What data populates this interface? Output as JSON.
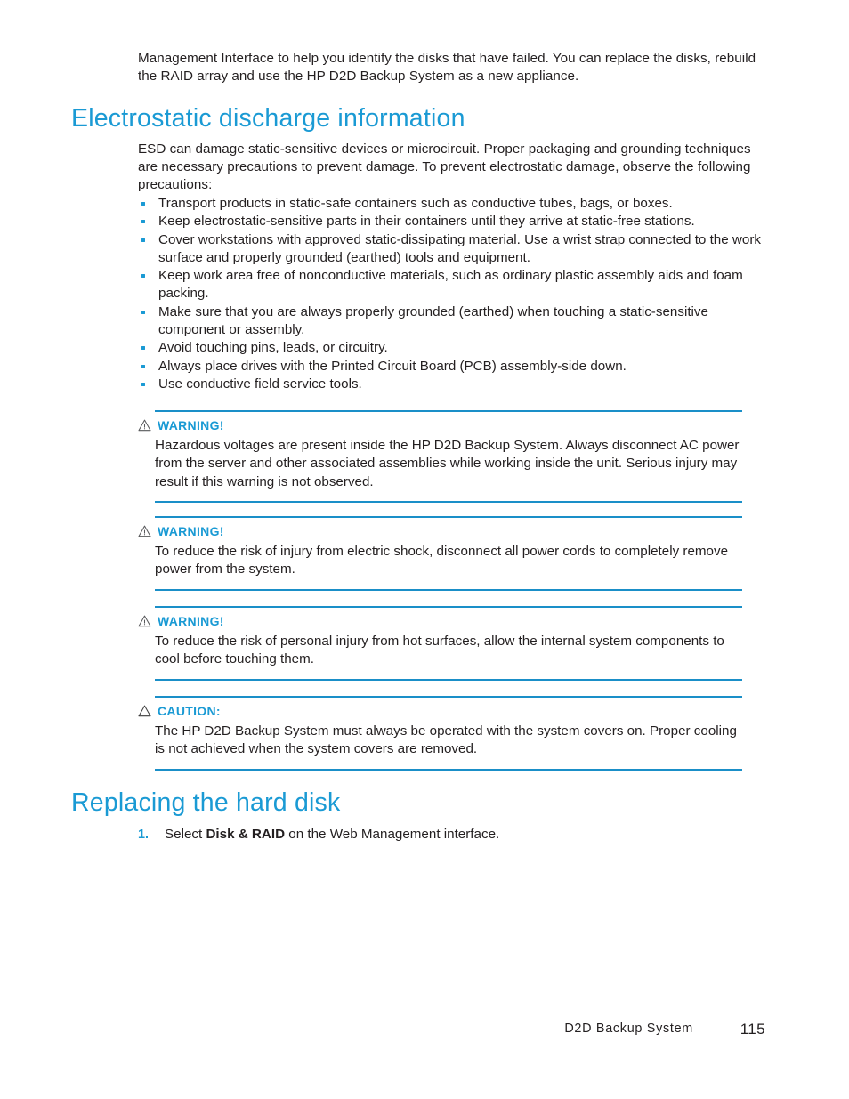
{
  "intro": {
    "paragraph": "Management Interface to help you identify the disks that have failed.  You can replace the disks, rebuild the RAID array and use the HP D2D Backup System as a new appliance."
  },
  "esd_section": {
    "heading": "Electrostatic discharge information",
    "paragraph": "ESD can damage static-sensitive devices or microcircuit.  Proper packaging and grounding techniques are necessary precautions to prevent damage.  To prevent electrostatic damage, observe the following precautions:",
    "bullets": [
      "Transport products in static-safe containers such as conductive tubes, bags, or boxes.",
      "Keep electrostatic-sensitive parts in their containers until they arrive at static-free stations.",
      "Cover workstations with approved static-dissipating material.  Use a wrist strap connected to the work surface and properly grounded (earthed) tools and equipment.",
      "Keep work area free of nonconductive materials, such as ordinary plastic assembly aids and foam packing.",
      "Make sure that you are always properly grounded (earthed) when touching a static-sensitive component or assembly.",
      "Avoid touching pins, leads, or circuitry.",
      "Always place drives with the Printed Circuit Board (PCB) assembly-side down.",
      "Use conductive field service tools."
    ]
  },
  "admonitions": [
    {
      "icon": "warning-triangle-icon",
      "label": "WARNING!",
      "text": "Hazardous voltages are present inside the HP D2D Backup System.  Always disconnect AC power from the server and other associated assemblies while working inside the unit. Serious injury may result if this warning is not observed."
    },
    {
      "icon": "warning-triangle-icon",
      "label": "WARNING!",
      "text": "To reduce the risk of injury from electric shock, disconnect all power cords to completely remove power from the system."
    },
    {
      "icon": "warning-triangle-icon",
      "label": "WARNING!",
      "text": "To reduce the risk of personal injury from hot surfaces, allow the internal system components to cool before touching them."
    },
    {
      "icon": "caution-triangle-icon",
      "label": "CAUTION:",
      "text": "The HP D2D Backup System must always be operated with the system covers on.  Proper cooling is not achieved when the system covers are removed."
    }
  ],
  "replace_section": {
    "heading": "Replacing the hard disk",
    "steps": [
      {
        "number": "1.",
        "prefix": "Select ",
        "bold": "Disk & RAID",
        "suffix": " on the Web Management interface."
      }
    ]
  },
  "footer": {
    "doc_title": "D2D Backup System",
    "page_number": "115"
  },
  "colors": {
    "heading_blue": "#1a9ad4",
    "rule_blue": "#1a8fc8",
    "body_text": "#231f20",
    "icon_gray": "#58595b"
  }
}
